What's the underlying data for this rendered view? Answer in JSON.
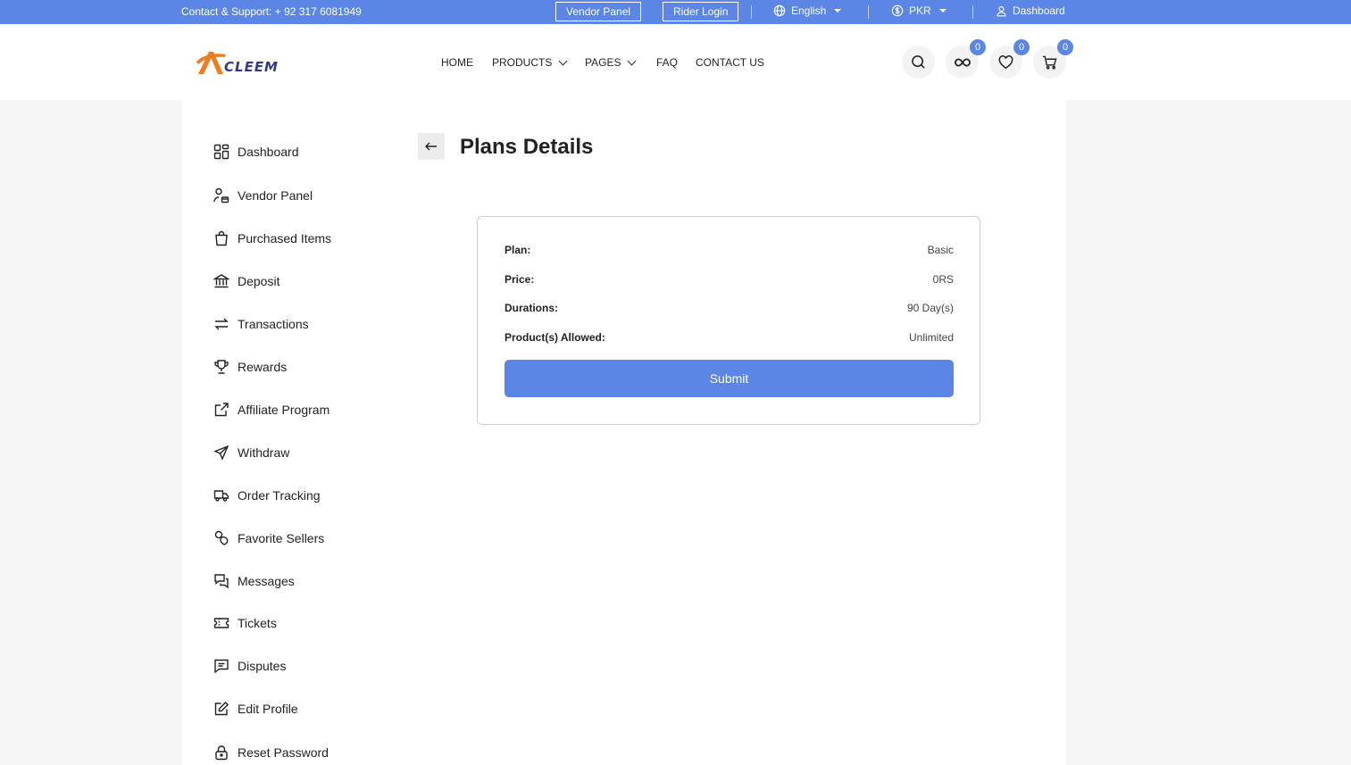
{
  "topbar": {
    "contact": "Contact & Support: + 92 317 6081949",
    "vendor_panel": "Vendor Panel",
    "rider_login": "Rider Login",
    "language": "English",
    "currency": "PKR",
    "dashboard": "Dashboard"
  },
  "header": {
    "logo_text": "CLEEM",
    "nav": [
      "HOME",
      "PRODUCTS",
      "PAGES",
      "FAQ",
      "CONTACT US"
    ],
    "compare_count": "0",
    "wishlist_count": "0",
    "cart_count": "0"
  },
  "sidebar": {
    "items": [
      {
        "label": "Dashboard",
        "icon": "grid-icon"
      },
      {
        "label": "Vendor Panel",
        "icon": "user-store-icon"
      },
      {
        "label": "Purchased Items",
        "icon": "bag-icon"
      },
      {
        "label": "Deposit",
        "icon": "bank-icon"
      },
      {
        "label": "Transactions",
        "icon": "arrows-exchange-icon"
      },
      {
        "label": "Rewards",
        "icon": "trophy-icon"
      },
      {
        "label": "Affiliate Program",
        "icon": "external-link-icon"
      },
      {
        "label": "Withdraw",
        "icon": "send-icon"
      },
      {
        "label": "Order Tracking",
        "icon": "truck-icon"
      },
      {
        "label": "Favorite Sellers",
        "icon": "favorite-icon"
      },
      {
        "label": "Messages",
        "icon": "chat-icon"
      },
      {
        "label": "Tickets",
        "icon": "ticket-icon"
      },
      {
        "label": "Disputes",
        "icon": "message-square-icon"
      },
      {
        "label": "Edit Profile",
        "icon": "edit-icon"
      },
      {
        "label": "Reset Password",
        "icon": "lock-icon"
      }
    ]
  },
  "main": {
    "title": "Plans Details",
    "details": [
      {
        "key": "Plan:",
        "value": "Basic"
      },
      {
        "key": "Price:",
        "value": "0RS"
      },
      {
        "key": "Durations:",
        "value": "90 Day(s)"
      },
      {
        "key": "Product(s) Allowed:",
        "value": "Unlimited"
      }
    ],
    "submit_label": "Submit"
  },
  "colors": {
    "accent": "#5b86e5",
    "logo_orange": "#f07c1d",
    "logo_navy": "#2f3a8f"
  }
}
